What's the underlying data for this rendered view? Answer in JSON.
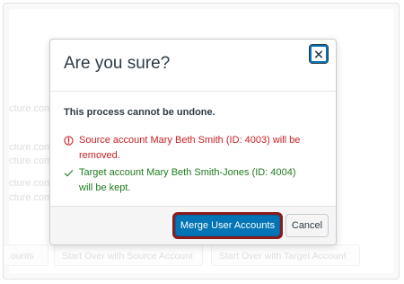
{
  "background": {
    "fragments": [
      "cture.com",
      "cture.com",
      "cture.com",
      "cture.com",
      "cture.com"
    ],
    "buttons": [
      "ounts",
      "Start Over with Source Account",
      "Start Over with Target Account"
    ]
  },
  "modal": {
    "title": "Are you sure?",
    "close_icon": "close-icon",
    "warning": "This process cannot be undone.",
    "messages": {
      "error": "Source account Mary Beth Smith (ID: 4003) will be removed.",
      "success": "Target account Mary Beth Smith-Jones (ID: 4004) will be kept."
    },
    "buttons": {
      "merge": "Merge User Accounts",
      "cancel": "Cancel"
    }
  },
  "colors": {
    "accent": "#0374b5",
    "error": "#c71f23",
    "success": "#1f7a1f",
    "highlight_ring": "#8a1c1c"
  }
}
